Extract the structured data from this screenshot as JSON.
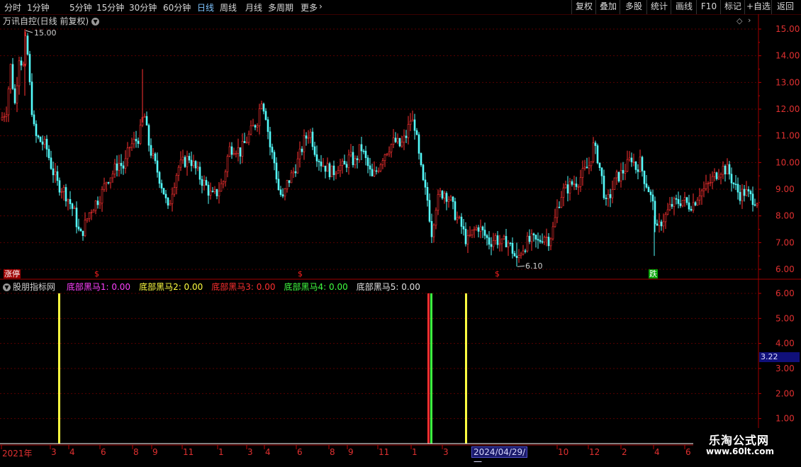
{
  "toolbar": {
    "periods": [
      "分时",
      "1分钟",
      "5分钟",
      "15分钟",
      "30分钟",
      "60分钟",
      "日线",
      "周线",
      "月线",
      "多周期",
      "更多"
    ],
    "active_period": "日线",
    "right_buttons": [
      "复权",
      "叠加",
      "多股",
      "统计",
      "画线",
      "F10",
      "标记",
      "+自选",
      "返回"
    ]
  },
  "main_chart": {
    "title": "万讯自控(日线 前复权)",
    "high_label": "15.00",
    "low_label": "6.10",
    "y_ticks": [
      "15.00",
      "14.00",
      "13.00",
      "12.00",
      "11.00",
      "10.00",
      "9.00",
      "8.00",
      "7.00",
      "6.00"
    ],
    "signals": [
      {
        "text": "涨停",
        "color": "#ffffff",
        "bg": "#a00000"
      },
      {
        "text": "$",
        "color": "#ff2020"
      },
      {
        "text": "$",
        "color": "#ff2020"
      },
      {
        "text": "$",
        "color": "#ff2020"
      },
      {
        "text": "跌",
        "color": "#ffffff",
        "bg": "#00a000"
      }
    ]
  },
  "indicator": {
    "name": "股朋指标网",
    "series": [
      {
        "label": "底部黑马1: 0.00",
        "color": "#ff40ff"
      },
      {
        "label": "底部黑马2: 0.00",
        "color": "#ffff40"
      },
      {
        "label": "底部黑马3: 0.00",
        "color": "#ff3030"
      },
      {
        "label": "底部黑马4: 0.00",
        "color": "#40ff40"
      },
      {
        "label": "底部黑马5: 0.00",
        "color": "#e0e0e0"
      }
    ],
    "y_ticks": [
      "6.00",
      "5.00",
      "4.00",
      "3.00",
      "2.00",
      "1.00"
    ],
    "cursor_value": "3.22"
  },
  "date_axis": {
    "labels": [
      "2021年",
      "3",
      "4",
      "6",
      "8",
      "9",
      "11",
      "1",
      "3",
      "4",
      "6",
      "8",
      "9",
      "11",
      "1",
      "3",
      "10",
      "12",
      "2",
      "4",
      "6"
    ],
    "cursor_date": "2024/04/29/一"
  },
  "watermark": {
    "line1": "乐淘公式网",
    "line2": "www.60lt.com"
  },
  "chart_data": {
    "type": "candlestick",
    "title": "万讯自控(日线 前复权)",
    "ylim": [
      5.8,
      15.3
    ],
    "annotations": [
      {
        "label": "15.00",
        "value": 15.0
      },
      {
        "label": "6.10",
        "value": 6.1
      }
    ],
    "price_path": [
      [
        0,
        11.6
      ],
      [
        8,
        12.0
      ],
      [
        14,
        13.6
      ],
      [
        20,
        12.2
      ],
      [
        26,
        14.0
      ],
      [
        32,
        13.6
      ],
      [
        36,
        14.8
      ],
      [
        42,
        12.5
      ],
      [
        48,
        11.0
      ],
      [
        56,
        10.8
      ],
      [
        64,
        10.6
      ],
      [
        72,
        9.8
      ],
      [
        80,
        9.2
      ],
      [
        88,
        9.0
      ],
      [
        96,
        8.6
      ],
      [
        104,
        8.1
      ],
      [
        112,
        7.2
      ],
      [
        118,
        7.6
      ],
      [
        126,
        8.2
      ],
      [
        134,
        8.5
      ],
      [
        142,
        8.8
      ],
      [
        150,
        9.4
      ],
      [
        158,
        9.6
      ],
      [
        166,
        10.0
      ],
      [
        174,
        9.8
      ],
      [
        182,
        10.6
      ],
      [
        190,
        10.8
      ],
      [
        196,
        11.0
      ],
      [
        202,
        11.9
      ],
      [
        208,
        10.8
      ],
      [
        214,
        10.2
      ],
      [
        222,
        9.6
      ],
      [
        230,
        8.9
      ],
      [
        236,
        8.2
      ],
      [
        242,
        9.0
      ],
      [
        250,
        9.8
      ],
      [
        258,
        10.0
      ],
      [
        266,
        10.2
      ],
      [
        274,
        9.8
      ],
      [
        282,
        9.4
      ],
      [
        290,
        9.1
      ],
      [
        298,
        8.7
      ],
      [
        306,
        8.9
      ],
      [
        314,
        9.3
      ],
      [
        322,
        10.5
      ],
      [
        330,
        10.6
      ],
      [
        338,
        10.4
      ],
      [
        346,
        10.8
      ],
      [
        354,
        11.2
      ],
      [
        362,
        11.6
      ],
      [
        368,
        12.4
      ],
      [
        374,
        11.8
      ],
      [
        380,
        10.6
      ],
      [
        386,
        10.0
      ],
      [
        392,
        9.0
      ],
      [
        398,
        8.6
      ],
      [
        404,
        9.2
      ],
      [
        412,
        9.6
      ],
      [
        420,
        10.1
      ],
      [
        428,
        10.8
      ],
      [
        436,
        11.2
      ],
      [
        444,
        10.4
      ],
      [
        452,
        10.0
      ],
      [
        460,
        9.8
      ],
      [
        468,
        9.6
      ],
      [
        476,
        9.9
      ],
      [
        484,
        9.8
      ],
      [
        492,
        10.2
      ],
      [
        500,
        10.0
      ],
      [
        508,
        10.6
      ],
      [
        516,
        10.0
      ],
      [
        524,
        9.4
      ],
      [
        532,
        9.8
      ],
      [
        540,
        10.3
      ],
      [
        548,
        10.6
      ],
      [
        556,
        10.8
      ],
      [
        564,
        10.6
      ],
      [
        572,
        11.0
      ],
      [
        578,
        11.6
      ],
      [
        584,
        11.4
      ],
      [
        590,
        10.2
      ],
      [
        596,
        9.2
      ],
      [
        602,
        8.6
      ],
      [
        608,
        7.4
      ],
      [
        614,
        8.4
      ],
      [
        620,
        8.8
      ],
      [
        626,
        8.9
      ],
      [
        634,
        8.6
      ],
      [
        642,
        8.0
      ],
      [
        650,
        7.6
      ],
      [
        658,
        7.0
      ],
      [
        666,
        7.4
      ],
      [
        674,
        7.6
      ],
      [
        682,
        7.3
      ],
      [
        690,
        7.0
      ],
      [
        698,
        7.2
      ],
      [
        706,
        6.9
      ],
      [
        714,
        7.1
      ],
      [
        722,
        6.7
      ],
      [
        728,
        6.3
      ],
      [
        734,
        6.7
      ],
      [
        742,
        7.0
      ],
      [
        750,
        7.1
      ],
      [
        758,
        7.0
      ],
      [
        766,
        7.3
      ],
      [
        774,
        7.1
      ],
      [
        780,
        7.6
      ],
      [
        786,
        8.4
      ],
      [
        792,
        8.9
      ],
      [
        798,
        9.0
      ],
      [
        806,
        9.2
      ],
      [
        814,
        9.3
      ],
      [
        822,
        9.6
      ],
      [
        830,
        9.9
      ],
      [
        836,
        10.6
      ],
      [
        842,
        10.2
      ],
      [
        848,
        9.4
      ],
      [
        854,
        8.4
      ],
      [
        860,
        8.8
      ],
      [
        868,
        9.4
      ],
      [
        876,
        9.6
      ],
      [
        884,
        9.9
      ],
      [
        890,
        10.2
      ],
      [
        896,
        9.8
      ],
      [
        902,
        10.0
      ],
      [
        908,
        9.4
      ],
      [
        914,
        9.0
      ],
      [
        920,
        8.4
      ],
      [
        926,
        7.4
      ],
      [
        932,
        7.8
      ],
      [
        938,
        8.0
      ],
      [
        946,
        8.4
      ],
      [
        954,
        8.5
      ],
      [
        962,
        8.6
      ],
      [
        970,
        8.4
      ],
      [
        978,
        8.5
      ],
      [
        986,
        8.9
      ],
      [
        994,
        9.0
      ],
      [
        1002,
        9.3
      ],
      [
        1010,
        9.6
      ],
      [
        1018,
        9.8
      ],
      [
        1026,
        9.7
      ],
      [
        1034,
        9.2
      ],
      [
        1042,
        8.8
      ],
      [
        1050,
        8.9
      ],
      [
        1058,
        8.7
      ],
      [
        1066,
        8.6
      ]
    ],
    "indicator_bars": [
      {
        "series": "底部黑马2",
        "value": 6.0
      },
      {
        "series": "底部黑马3",
        "value": 6.0
      },
      {
        "series": "底部黑马4",
        "value": 6.0
      },
      {
        "series": "底部黑马2",
        "value": 6.0
      }
    ]
  }
}
